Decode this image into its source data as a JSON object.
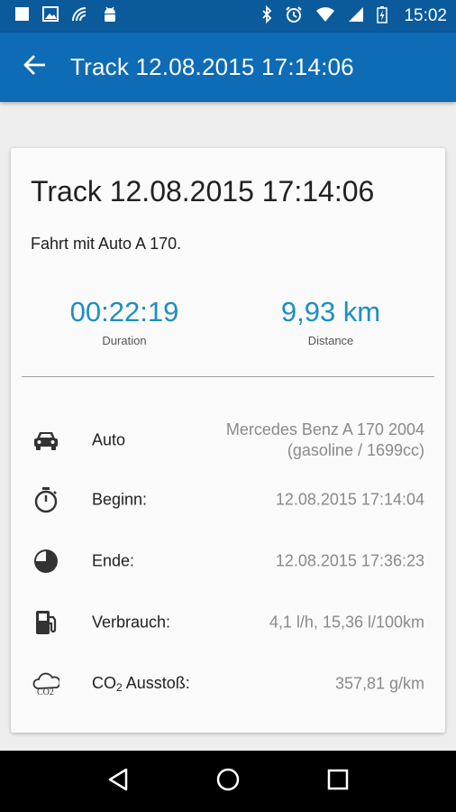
{
  "status_bar": {
    "time": "15:02",
    "icons": [
      "notification-square-icon",
      "image-icon",
      "wifi-signal-icon",
      "android-icon",
      "bluetooth-icon",
      "alarm-icon",
      "wifi-icon",
      "cell-signal-icon",
      "battery-icon"
    ]
  },
  "app_bar": {
    "title": "Track 12.08.2015 17:14:06"
  },
  "card": {
    "title": "Track 12.08.2015 17:14:06",
    "description": "Fahrt mit Auto A 170.",
    "duration": {
      "value": "00:22:19",
      "label": "Duration"
    },
    "distance": {
      "value": "9,93 km",
      "label": "Distance"
    },
    "rows": [
      {
        "icon": "car-icon",
        "label": "Auto",
        "value_line1": "Mercedes Benz A 170 2004",
        "value_line2": "(gasoline / 1699cc)"
      },
      {
        "icon": "stopwatch-icon",
        "label": "Beginn:",
        "value": "12.08.2015 17:14:04"
      },
      {
        "icon": "clock-end-icon",
        "label": "Ende:",
        "value": "12.08.2015 17:36:23"
      },
      {
        "icon": "fuel-pump-icon",
        "label": "Verbrauch:",
        "value": "4,1 l/h, 15,36 l/100km"
      },
      {
        "icon": "co2-cloud-icon",
        "label_main": "CO",
        "label_sub": "2",
        "label_rest": " Ausstoß:",
        "icon_text": "CO2",
        "value": "357,81 g/km"
      }
    ]
  },
  "colors": {
    "status_bar": "#0b5a9c",
    "app_bar": "#0e6bb5",
    "accent": "#1b8fc1"
  }
}
